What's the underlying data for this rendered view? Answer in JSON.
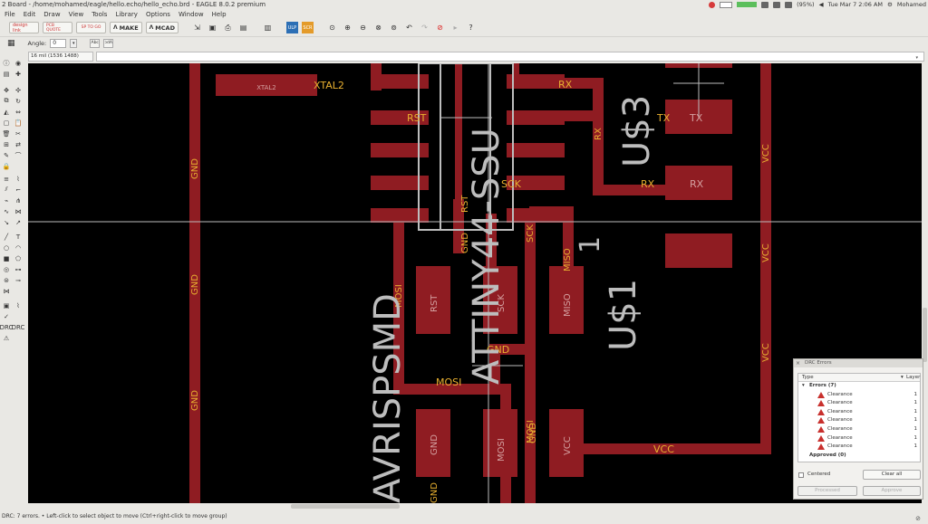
{
  "window": {
    "title": "2 Board - /home/mohamed/eagle/hello.echo/hello_echo.brd - EAGLE 8.0.2 premium",
    "battery": "(95%)",
    "clock": "Tue Mar 7 2:06 AM",
    "user": "Mohamed"
  },
  "menu": [
    "File",
    "Edit",
    "Draw",
    "View",
    "Tools",
    "Library",
    "Options",
    "Window",
    "Help"
  ],
  "toolbar": {
    "design_link": "design link",
    "pcb_quote": "PCB QUOTE",
    "sp_to_go": "SP TO GO",
    "make": "MAKE",
    "mcad": "MCAD"
  },
  "params": {
    "angle_label": "Angle:",
    "angle_value": "0"
  },
  "coords": "16 mil (1536 1488)",
  "status": "DRC: 7 errors.  • Left-click to select object to move (Ctrl+right-click to move group)",
  "board": {
    "nets": {
      "gnd": "GND",
      "vcc": "VCC",
      "xtal2": "XTAL2",
      "rx": "RX",
      "tx": "TX",
      "rst": "RST",
      "sck": "SCK",
      "miso": "MISO",
      "mosi": "MOSI"
    },
    "pads": {
      "xtal2": "XTAL2",
      "tx": "TX",
      "rx": "RX",
      "rst": "RST",
      "sck": "SCK",
      "miso": "MISO",
      "gnd": "GND",
      "mosi": "MOSI",
      "vcc": "VCC"
    },
    "silk": {
      "attiny": "ATTINY44-SSU",
      "avrispsmd": "AVRISPSMD",
      "us3": "U$3",
      "us1": "U$1",
      "one": "1"
    }
  },
  "drc": {
    "title": "DRC Errors",
    "col_type": "Type",
    "col_layer": "Layer",
    "errors_header": "Errors (7)",
    "errors": [
      {
        "type": "Clearance",
        "layer": "1"
      },
      {
        "type": "Clearance",
        "layer": "1"
      },
      {
        "type": "Clearance",
        "layer": "1"
      },
      {
        "type": "Clearance",
        "layer": "1"
      },
      {
        "type": "Clearance",
        "layer": "1"
      },
      {
        "type": "Clearance",
        "layer": "1"
      },
      {
        "type": "Clearance",
        "layer": "1"
      }
    ],
    "approved_header": "Approved (0)",
    "centered": "Centered",
    "clear_all": "Clear all",
    "processed": "Processed",
    "approve": "Approve"
  },
  "colors": {
    "copper": "#8f1c22",
    "silk": "#bdbdbd",
    "net_label": "#e8b030",
    "background": "#000000"
  }
}
